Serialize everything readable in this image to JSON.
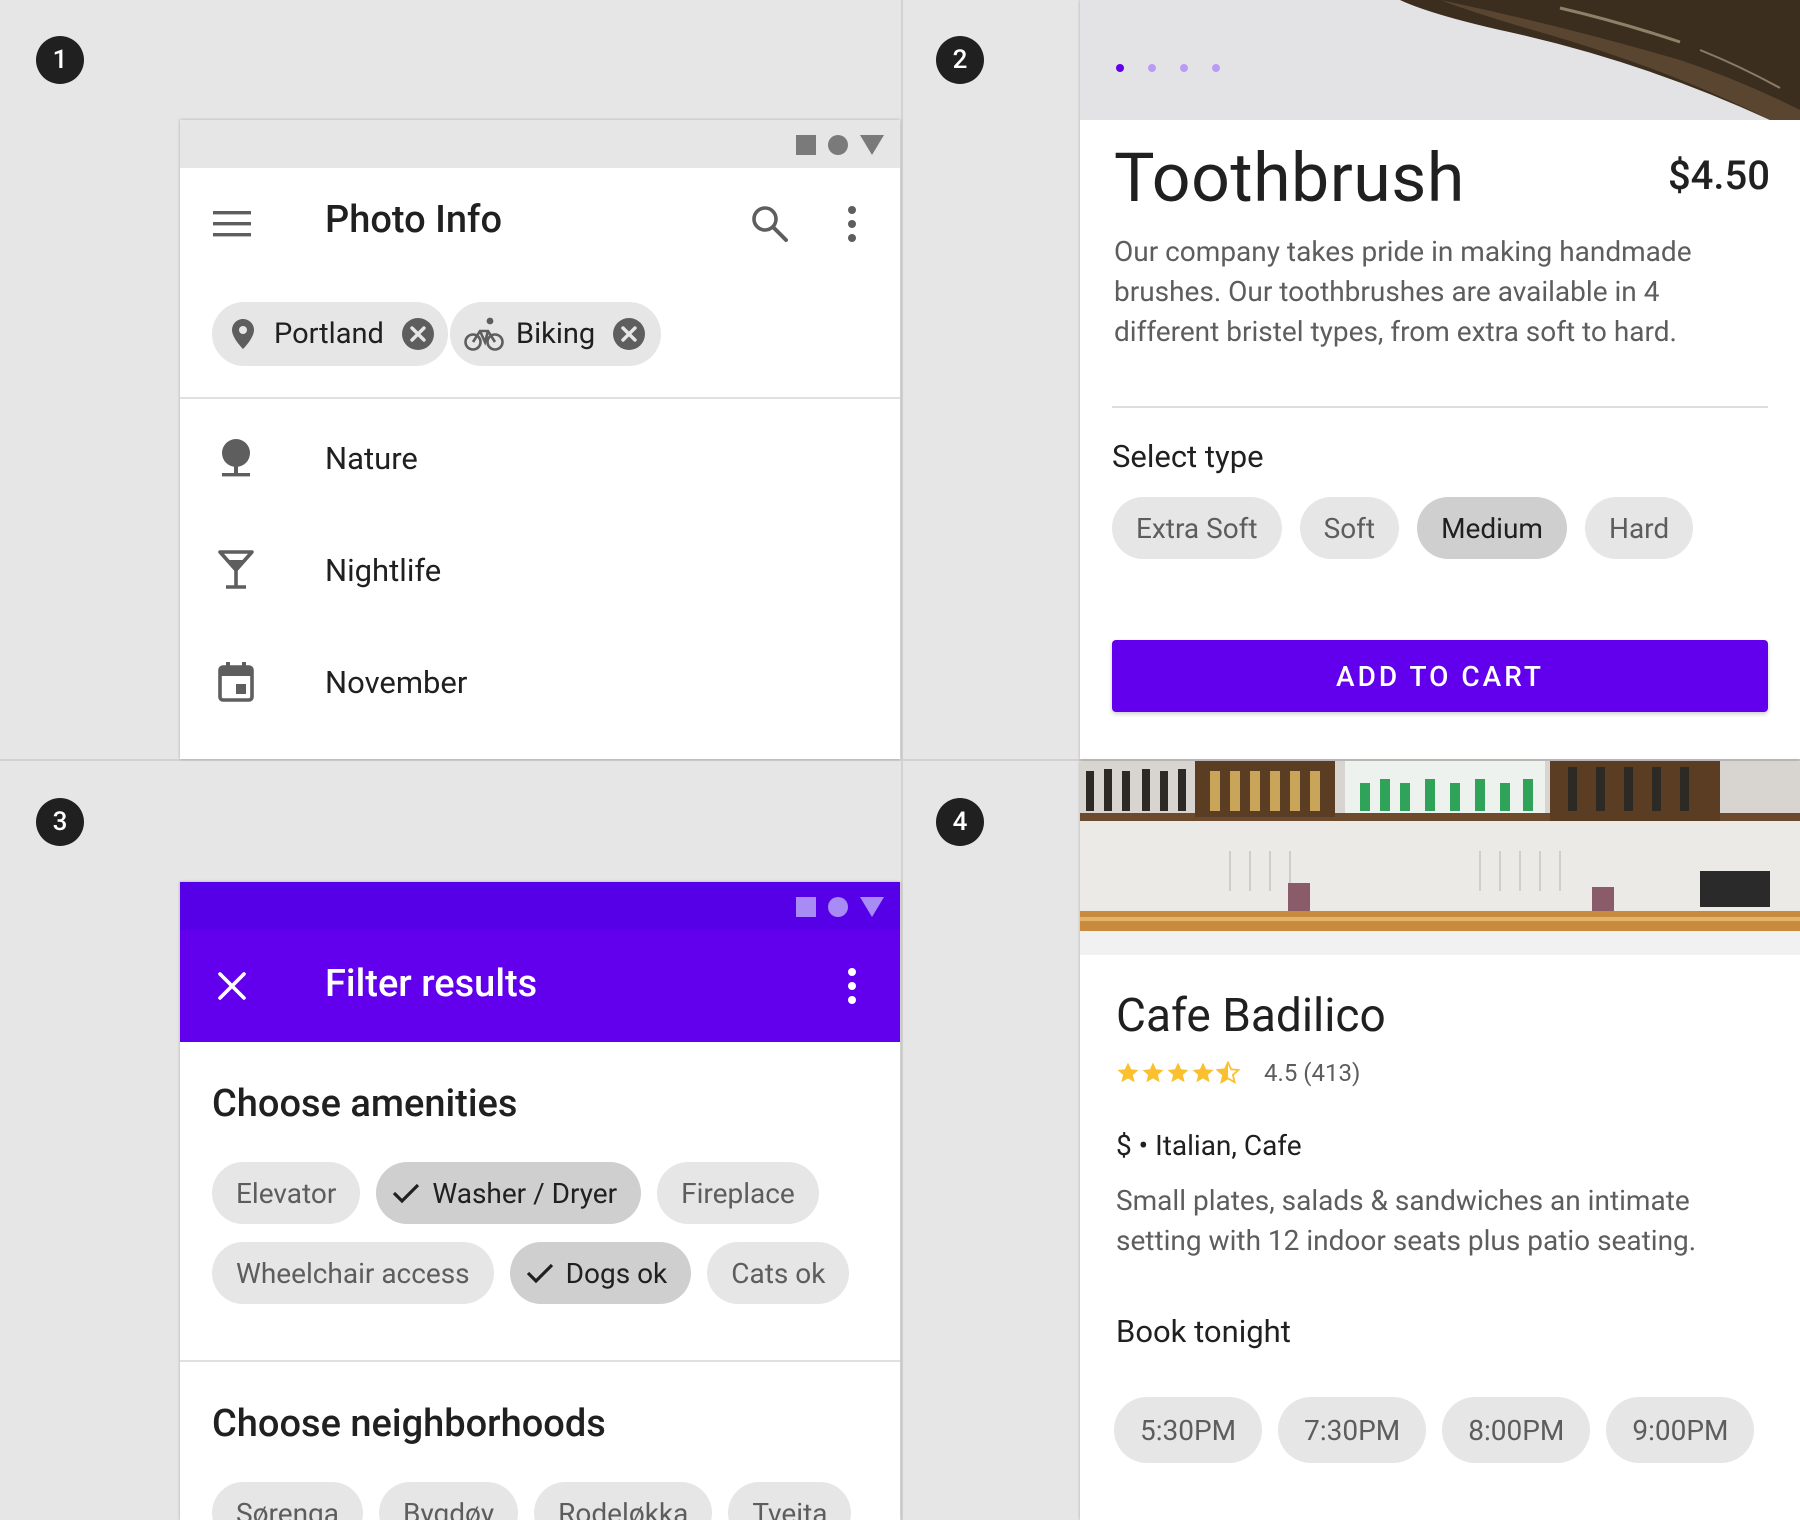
{
  "badges": [
    "1",
    "2",
    "3",
    "4"
  ],
  "colors": {
    "accent": "#6200ee",
    "accent_dark": "#5600e8",
    "star": "#fbc02d"
  },
  "photo_info": {
    "title": "Photo Info",
    "menu_icon": "menu-icon",
    "search_icon": "search-icon",
    "more_icon": "more-vert-icon",
    "filter_chips": [
      {
        "label": "Portland",
        "icon": "location-pin-icon"
      },
      {
        "label": "Biking",
        "icon": "bike-icon"
      }
    ],
    "items": [
      {
        "label": "Nature",
        "icon": "tree-icon"
      },
      {
        "label": "Nightlife",
        "icon": "cocktail-icon"
      },
      {
        "label": "November",
        "icon": "calendar-icon"
      }
    ]
  },
  "product": {
    "title": "Toothbrush",
    "price": "$4.50",
    "description": "Our company takes pride in making handmade brushes. Our toothbrushes are available in 4 different bristel types, from extra soft to hard.",
    "select_label": "Select type",
    "types": [
      {
        "label": "Extra Soft",
        "selected": false
      },
      {
        "label": "Soft",
        "selected": false
      },
      {
        "label": "Medium",
        "selected": true
      },
      {
        "label": "Hard",
        "selected": false
      }
    ],
    "cart_button": "ADD TO CART",
    "carousel_pages": 4,
    "carousel_active": 1
  },
  "filter": {
    "title": "Filter results",
    "amenities_heading": "Choose amenities",
    "amenities": [
      {
        "label": "Elevator",
        "selected": false
      },
      {
        "label": "Washer / Dryer",
        "selected": true
      },
      {
        "label": "Fireplace",
        "selected": false
      },
      {
        "label": "Wheelchair access",
        "selected": false
      },
      {
        "label": "Dogs ok",
        "selected": true
      },
      {
        "label": "Cats ok",
        "selected": false
      }
    ],
    "neighborhoods_heading": "Choose neighborhoods",
    "neighborhoods": [
      "Sørenga",
      "Bygdøy",
      "Rodeløkka",
      "Tveita"
    ]
  },
  "cafe": {
    "name": "Cafe Badilico",
    "rating": 4.5,
    "rating_text": "4.5 (413)",
    "info": "$ • Italian, Cafe",
    "description": "Small plates, salads & sandwiches an intimate setting with 12 indoor seats plus patio seating.",
    "book_label": "Book tonight",
    "times": [
      "5:30PM",
      "7:30PM",
      "8:00PM",
      "9:00PM"
    ]
  }
}
